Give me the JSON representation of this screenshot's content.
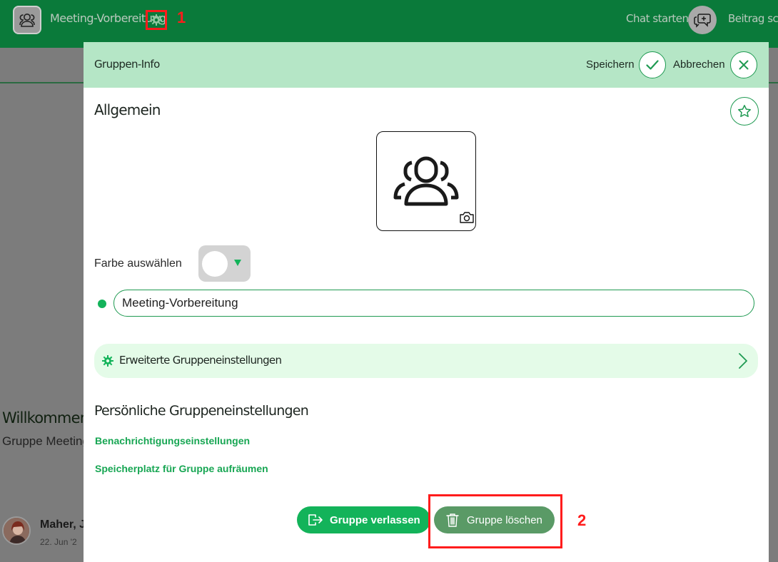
{
  "topbar": {
    "title": "Meeting-Vorbereitung",
    "chat_start": "Chat starten",
    "post_label": "Beitrag schreiben",
    "marker_1": "1",
    "accent_color": "#0a7a3a"
  },
  "background": {
    "welcome": "Willkommen",
    "group_text": "Gruppe Meeting-Vorbereitung",
    "user_name": "Maher, J",
    "user_date": "22. Jun '2"
  },
  "modal": {
    "title": "Gruppen-Info",
    "save_label": "Speichern",
    "cancel_label": "Abbrechen",
    "general_heading": "Allgemein",
    "color_label": "Farbe auswählen",
    "name_value": "Meeting-Vorbereitung",
    "advanced_label": "Erweiterte Gruppeneinstellungen",
    "personal_heading": "Persönliche Gruppeneinstellungen",
    "link_notifications": "Benachrichtigungseinstellungen",
    "link_storage": "Speicherplatz für Gruppe aufräumen",
    "leave_button": "Gruppe verlassen",
    "delete_button": "Gruppe löschen",
    "marker_2": "2"
  },
  "colors": {
    "header_bg": "#b5e6c6",
    "primary_green": "#13b35a",
    "delete_green": "#5a9a66",
    "highlight_red": "#ff1c1c"
  }
}
